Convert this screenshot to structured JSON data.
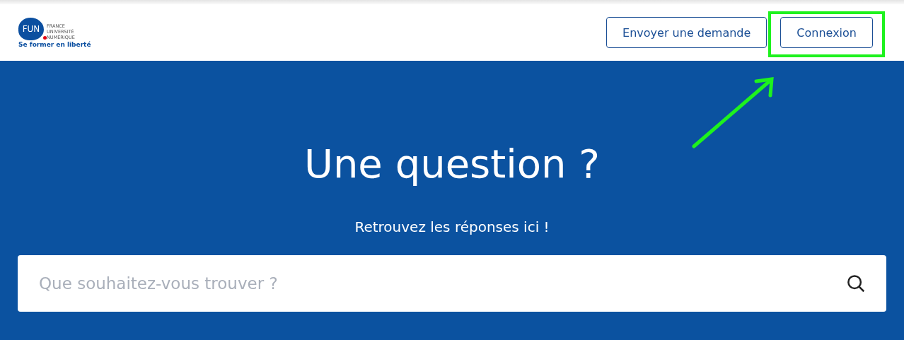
{
  "header": {
    "logo": {
      "mark": "FUN",
      "lines": [
        "FRANCE",
        "UNIVERSITÉ",
        "NUMÉRIQUE"
      ],
      "tagline": "Se former en liberté"
    },
    "buttons": [
      {
        "label": "Envoyer une demande",
        "highlighted": false
      },
      {
        "label": "Connexion",
        "highlighted": true
      }
    ]
  },
  "hero": {
    "title": "Une question ?",
    "subtitle": "Retrouvez les réponses ici !",
    "search": {
      "placeholder": "Que souhaitez-vous trouver ?"
    }
  }
}
